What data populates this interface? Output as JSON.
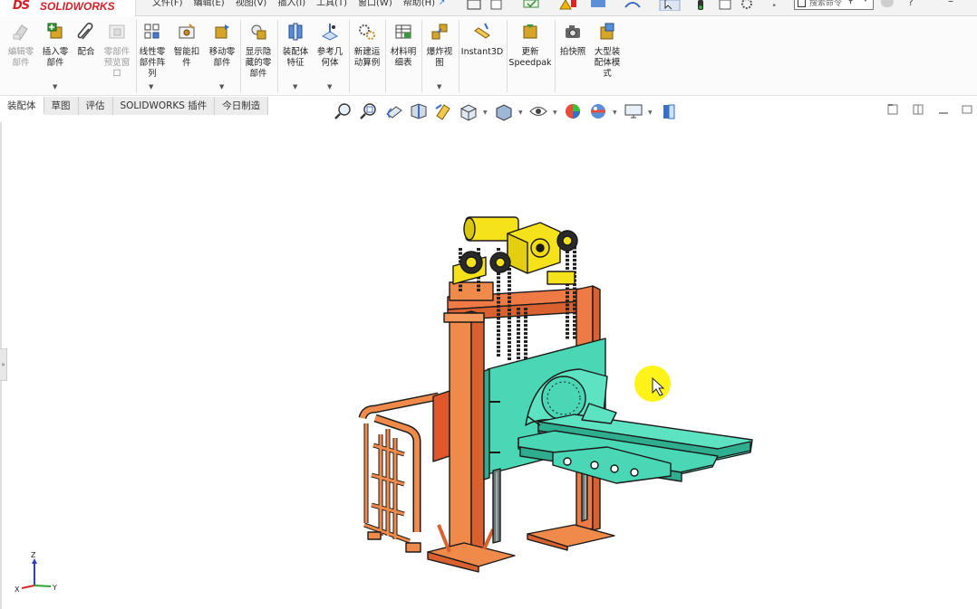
{
  "app": {
    "brand_ds": "DS",
    "brand_name": "SOLIDWORKS"
  },
  "menu": [
    "文件(F)",
    "编辑(E)",
    "视图(V)",
    "插入(I)",
    "工具(T)",
    "窗口(W)",
    "帮助(H)"
  ],
  "search": {
    "placeholder": "搜索命令"
  },
  "ribbon": {
    "buttons": [
      {
        "label1": "编辑零",
        "label2": "部件",
        "label3": "",
        "dim": true
      },
      {
        "label1": "插入零",
        "label2": "部件",
        "label3": ""
      },
      {
        "label1": "配合",
        "label2": "",
        "label3": ""
      },
      {
        "label1": "零部件",
        "label2": "预览窗",
        "label3": "口",
        "dim": true
      },
      {
        "label1": "线性零",
        "label2": "部件阵",
        "label3": "列"
      },
      {
        "label1": "智能扣",
        "label2": "件",
        "label3": ""
      },
      {
        "label1": "移动零",
        "label2": "部件",
        "label3": ""
      },
      {
        "label1": "显示隐",
        "label2": "藏的零",
        "label3": "部件"
      },
      {
        "label1": "装配体",
        "label2": "特征",
        "label3": ""
      },
      {
        "label1": "参考几",
        "label2": "何体",
        "label3": ""
      },
      {
        "label1": "新建运",
        "label2": "动算例",
        "label3": ""
      },
      {
        "label1": "材料明",
        "label2": "细表",
        "label3": ""
      },
      {
        "label1": "爆炸视",
        "label2": "图",
        "label3": ""
      },
      {
        "label1": "Instant3D",
        "label2": "",
        "label3": ""
      },
      {
        "label1": "更新",
        "label2": "Speedpak",
        "label3": ""
      },
      {
        "label1": "拍快照",
        "label2": "",
        "label3": ""
      },
      {
        "label1": "大型装",
        "label2": "配体模",
        "label3": "式"
      }
    ]
  },
  "tabs": [
    "装配体",
    "草图",
    "评估",
    "SOLIDWORKS 插件",
    "今日制造"
  ],
  "triad": {
    "z": "Z",
    "x": "X",
    "y": "Y"
  },
  "colors": {
    "frame_orange": "#f08a4b",
    "plate_teal": "#49d7b5",
    "motor_yellow": "#f6e21a",
    "cursor_highlight": "#fff200"
  }
}
